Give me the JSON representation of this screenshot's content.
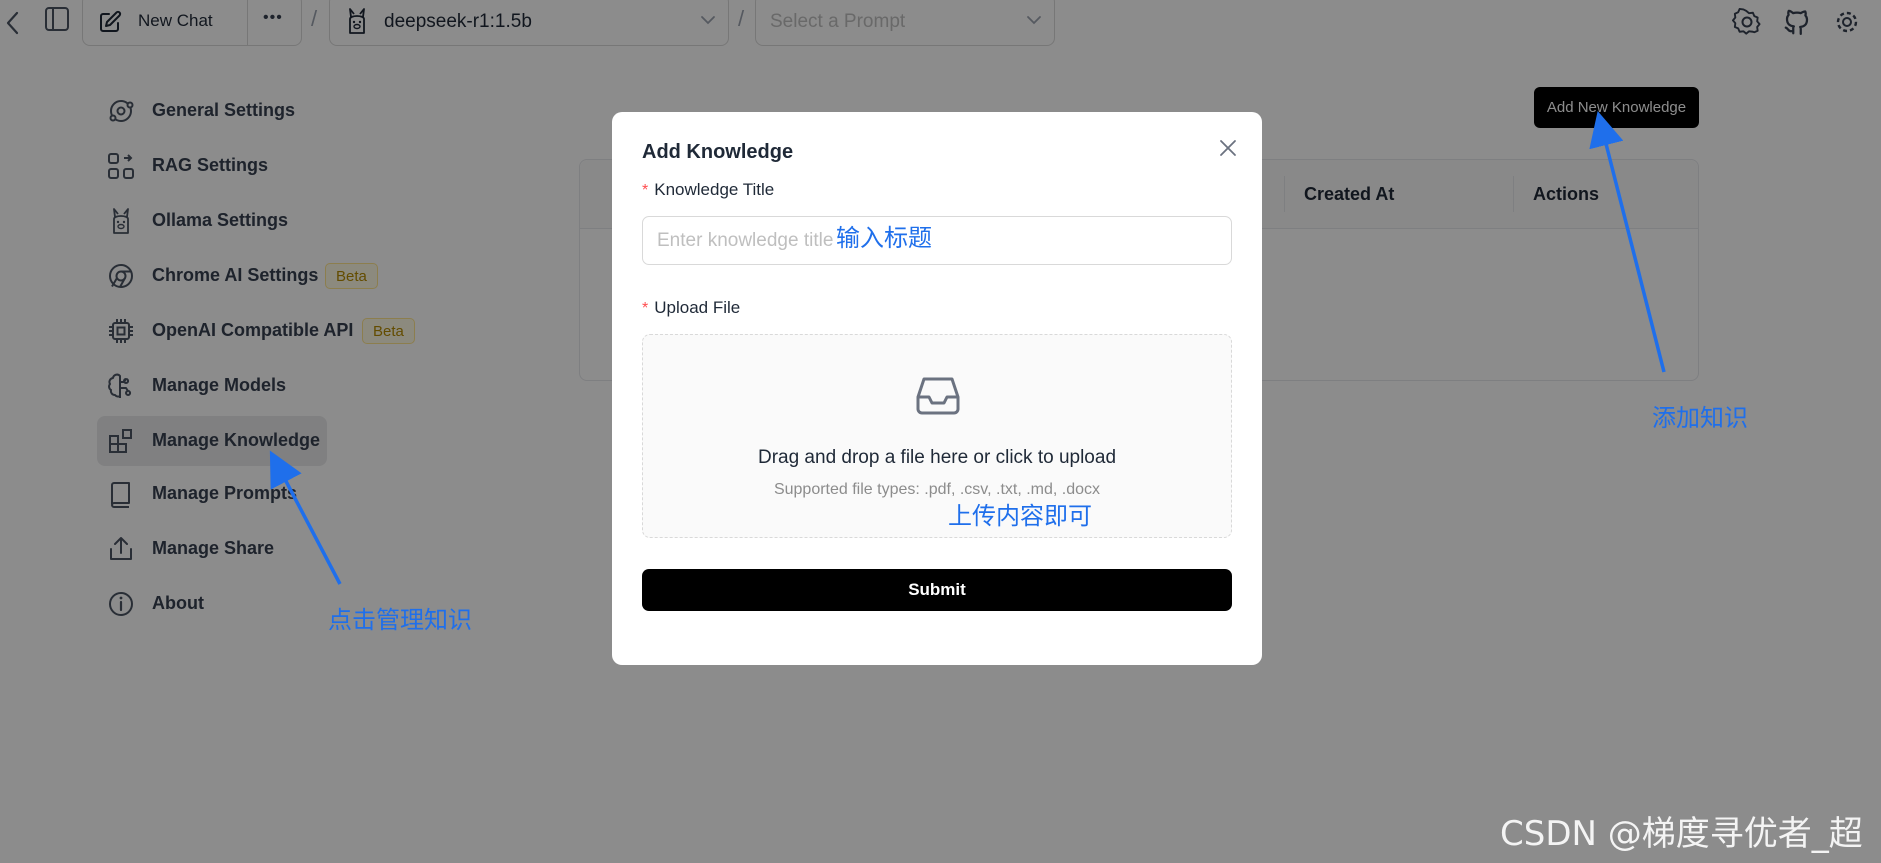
{
  "topbar": {
    "new_chat_label": "New Chat",
    "more_label": "•••",
    "model_selected": "deepseek-r1:1.5b",
    "prompt_placeholder": "Select a Prompt",
    "separator": "/"
  },
  "sidebar": {
    "items": [
      {
        "label": "General Settings",
        "icon": "general-settings-icon"
      },
      {
        "label": "RAG Settings",
        "icon": "rag-settings-icon"
      },
      {
        "label": "Ollama Settings",
        "icon": "ollama-icon"
      },
      {
        "label": "Chrome AI Settings",
        "icon": "chrome-icon",
        "badge": "Beta"
      },
      {
        "label": "OpenAI Compatible API",
        "icon": "cpu-chip-icon",
        "badge": "Beta"
      },
      {
        "label": "Manage Models",
        "icon": "brain-icon"
      },
      {
        "label": "Manage Knowledge",
        "icon": "blocks-icon",
        "active": true
      },
      {
        "label": "Manage Prompts",
        "icon": "book-icon"
      },
      {
        "label": "Manage Share",
        "icon": "share-icon"
      },
      {
        "label": "About",
        "icon": "info-icon"
      }
    ]
  },
  "knowledge_page": {
    "add_button_label": "Add New Knowledge",
    "table_headers": {
      "created_at": "Created At",
      "actions": "Actions"
    }
  },
  "modal": {
    "title": "Add Knowledge",
    "required_mark": "*",
    "title_field_label": "Knowledge Title",
    "title_field_placeholder": "Enter knowledge title",
    "title_field_value": "",
    "upload_label": "Upload File",
    "upload_main_text": "Drag and drop a file here or click to upload",
    "upload_sub_text": "Supported file types: .pdf, .csv, .txt, .md, .docx",
    "submit_label": "Submit"
  },
  "annotations": {
    "title_hint": "输入标题",
    "upload_hint": "上传内容即可",
    "add_hint": "添加知识",
    "manage_hint": "点击管理知识",
    "arrow_color": "#1f6feb"
  },
  "watermark": "CSDN @梯度寻优者_超",
  "colors": {
    "overlay": "rgba(0,0,0,0.45)",
    "primary_button": "#000000",
    "beta_badge_text": "#b58a00",
    "required": "#ff4d4f"
  }
}
